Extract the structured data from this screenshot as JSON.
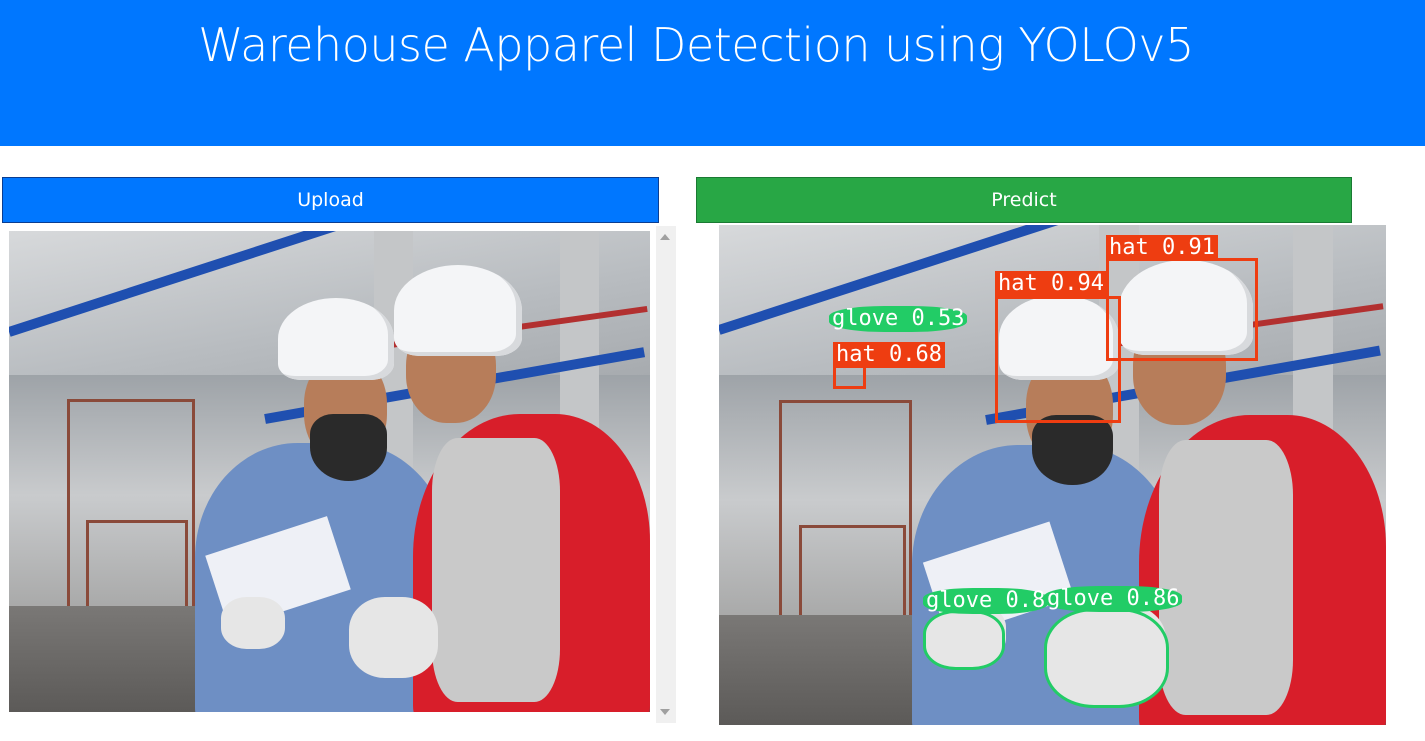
{
  "header": {
    "title": "Warehouse Apparel Detection using YOLOv5"
  },
  "buttons": {
    "upload_label": "Upload",
    "predict_label": "Predict"
  },
  "colors": {
    "header_bg": "#0077ff",
    "upload_bg": "#0077ff",
    "predict_bg": "#28a745",
    "hat_box": "#ee3d11",
    "glove_box": "#22cc66"
  },
  "detections": [
    {
      "class": "hat",
      "label": "hat 0.91"
    },
    {
      "class": "hat",
      "label": "hat 0.94"
    },
    {
      "class": "glove",
      "label": "glove 0.53"
    },
    {
      "class": "hat",
      "label": "hat 0.68"
    },
    {
      "class": "glove",
      "label": "glove 0.8"
    },
    {
      "class": "glove",
      "label": "glove 0.86"
    }
  ]
}
